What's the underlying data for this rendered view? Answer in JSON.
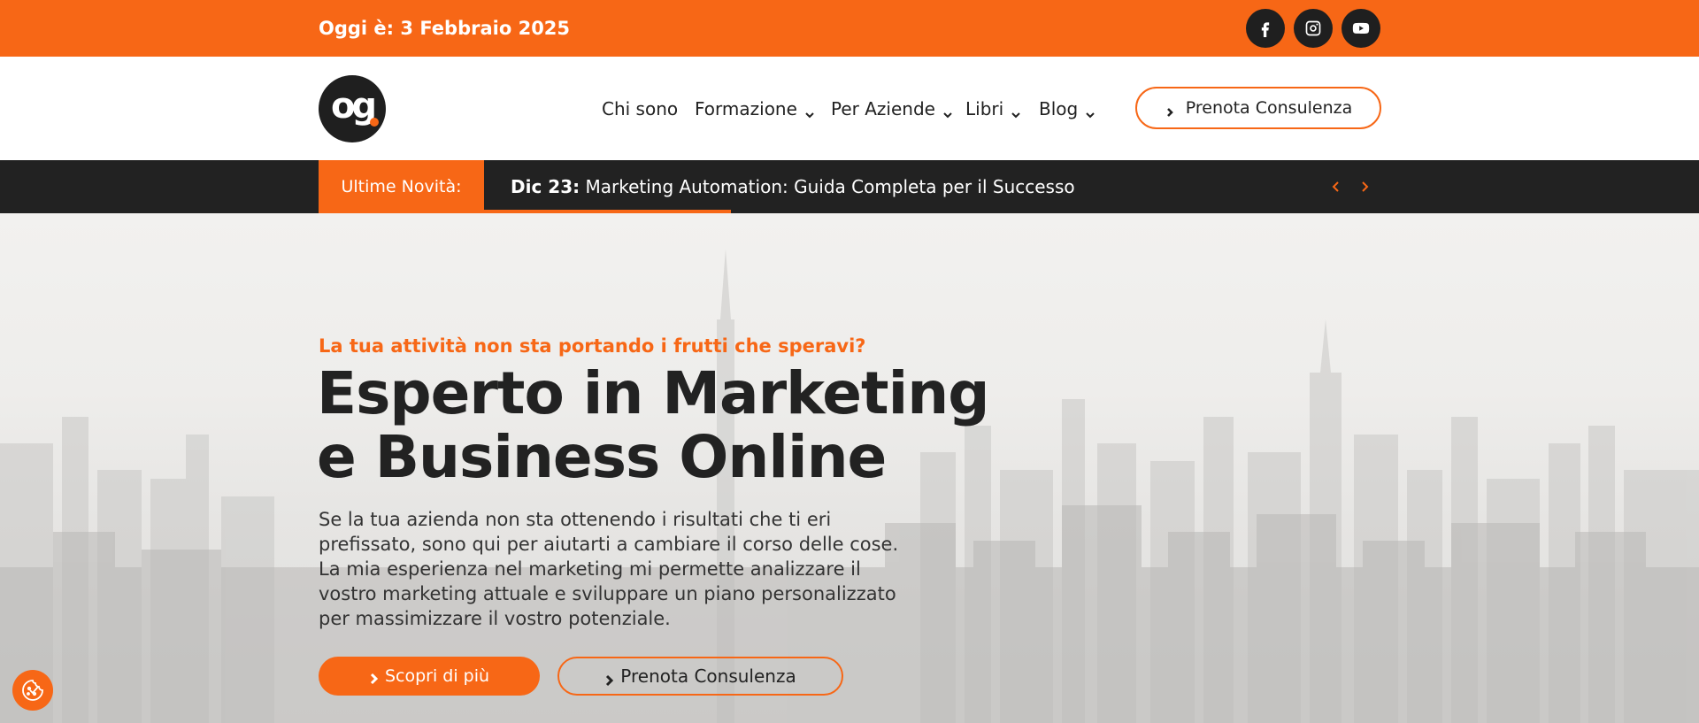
{
  "topbar": {
    "date_prefix": "Oggi è:",
    "date_value": "3 Febbraio 2025",
    "social": [
      {
        "icon": "facebook-icon"
      },
      {
        "icon": "instagram-icon"
      },
      {
        "icon": "youtube-icon"
      }
    ],
    "bg_color": "#f76716"
  },
  "header": {
    "logo_text": "og",
    "nav": [
      {
        "label": "Chi sono",
        "has_dropdown": false
      },
      {
        "label": "Formazione",
        "has_dropdown": true
      },
      {
        "label": "Per Aziende",
        "has_dropdown": true
      },
      {
        "label": "Libri",
        "has_dropdown": true
      },
      {
        "label": "Blog",
        "has_dropdown": true
      }
    ],
    "cta_label": "Prenota Consulenza"
  },
  "ticker": {
    "label": "Ultime Novità:",
    "date": "Dic 23:",
    "headline": "Marketing Automation: Guida Completa per il Successo",
    "progress": 0.3
  },
  "hero": {
    "kicker": "La tua attività non sta portando i frutti che speravi?",
    "title_line1": "Esperto in Marketing",
    "title_line2": "e Business Online",
    "description": "Se la tua azienda non sta ottenendo i risultati che ti eri prefissato, sono qui per aiutarti a cambiare il corso delle cose. La mia esperienza nel marketing mi permette analizzare il vostro marketing attuale e sviluppare un piano personalizzato per massimizzare il vostro potenziale.",
    "primary_button": "Scopri di più",
    "secondary_button": "Prenota Consulenza"
  },
  "colors": {
    "accent": "#f76716",
    "dark": "#222222"
  }
}
